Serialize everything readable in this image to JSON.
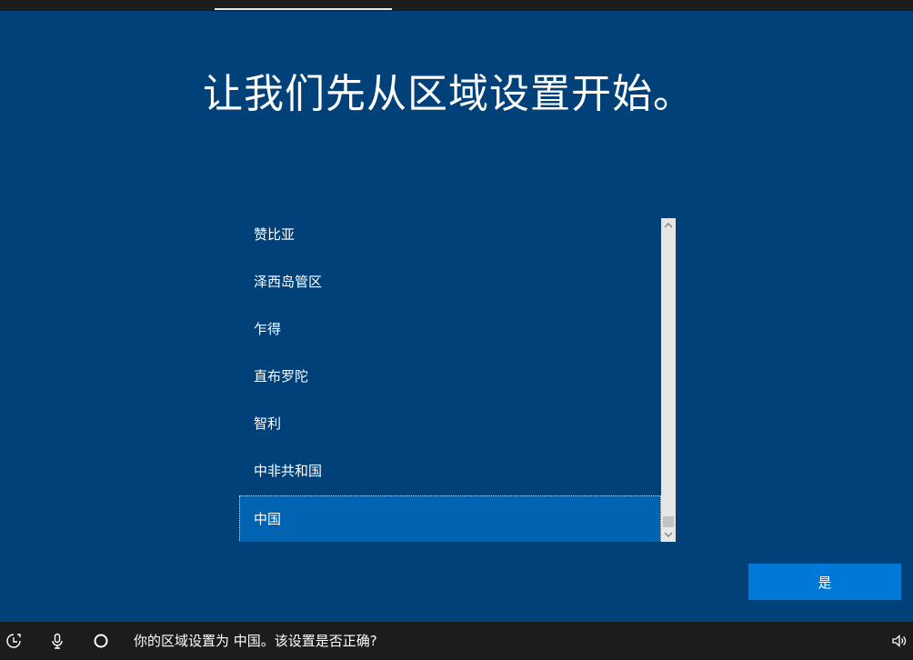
{
  "title": "让我们先从区域设置开始。",
  "region_list": {
    "items": [
      {
        "label": "赞比亚",
        "selected": false
      },
      {
        "label": "泽西岛管区",
        "selected": false
      },
      {
        "label": "乍得",
        "selected": false
      },
      {
        "label": "直布罗陀",
        "selected": false
      },
      {
        "label": "智利",
        "selected": false
      },
      {
        "label": "中非共和国",
        "selected": false
      },
      {
        "label": "中国",
        "selected": true
      }
    ]
  },
  "buttons": {
    "yes_label": "是"
  },
  "taskbar": {
    "narrator_text": "你的区域设置为 中国。该设置是否正确?",
    "icons": [
      "accessibility-icon",
      "microphone-icon",
      "cortana-circle-icon",
      "volume-icon"
    ]
  },
  "colors": {
    "background": "#01417a",
    "selected_item": "#0063b1",
    "accent_button": "#0078d7",
    "taskbar": "#1c1c1c"
  }
}
